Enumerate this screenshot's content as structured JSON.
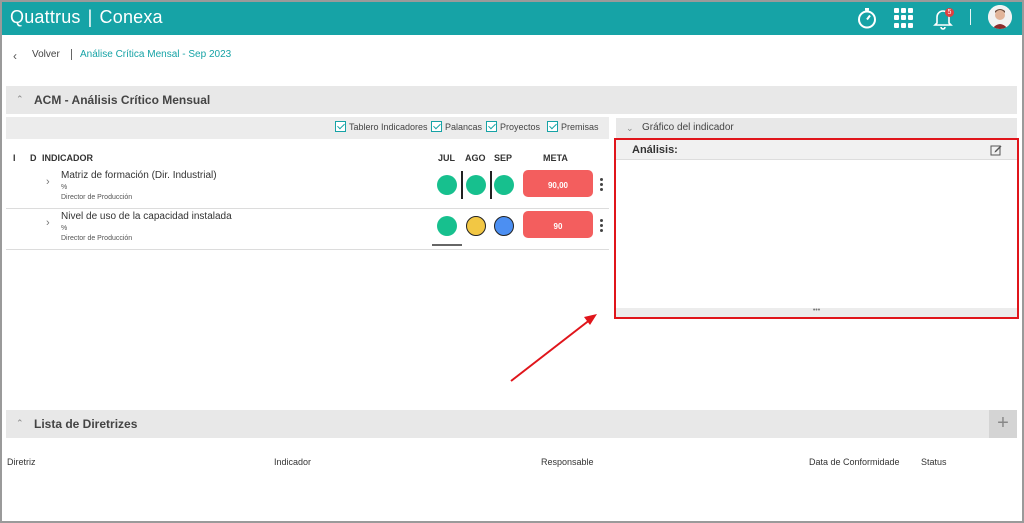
{
  "header": {
    "brand_left": "Quattrus",
    "brand_sep": "|",
    "brand_right": "Conexa",
    "notification_count": "5",
    "bg_color": "#16a3a6"
  },
  "breadcrumb": {
    "back_label": "Volver",
    "current": "Análise Crítica Mensal - Sep 2023"
  },
  "acm_section": {
    "title": "ACM - Análisis Crítico Mensual"
  },
  "filters": [
    {
      "label": "Tablero Indicadores",
      "checked": true
    },
    {
      "label": "Palancas",
      "checked": true
    },
    {
      "label": "Proyectos",
      "checked": true
    },
    {
      "label": "Premisas",
      "checked": true
    }
  ],
  "table": {
    "headers": {
      "i": "I",
      "d": "D",
      "indicator": "INDICADOR",
      "jul": "JUL",
      "ago": "AGO",
      "sep": "SEP",
      "meta": "META"
    },
    "rows": [
      {
        "name": "Matriz de formación (Dir. Industrial)",
        "unit": "%",
        "owner": "Director de Producción",
        "status": [
          "green",
          "green",
          "green"
        ],
        "meta": "90,00"
      },
      {
        "name": "Nivel de uso de la capacidad instalada",
        "unit": "%",
        "owner": "Director de Producción",
        "status": [
          "green",
          "yellow",
          "blue"
        ],
        "meta": "90"
      }
    ]
  },
  "chart_panel": {
    "title": "Gráfico del indicador",
    "analysis_title": "Análisis:",
    "footer": "•••"
  },
  "lista_section": {
    "title": "Lista de Diretrizes",
    "add_label": "+",
    "columns": [
      "Diretriz",
      "Indicador",
      "Responsable",
      "Data de Conformidade",
      "Status"
    ]
  },
  "colors": {
    "green": "#17c08e",
    "yellow": "#f2c744",
    "blue": "#4c8ff2",
    "meta_red": "#f35e5e",
    "highlight": "#e0151b"
  }
}
